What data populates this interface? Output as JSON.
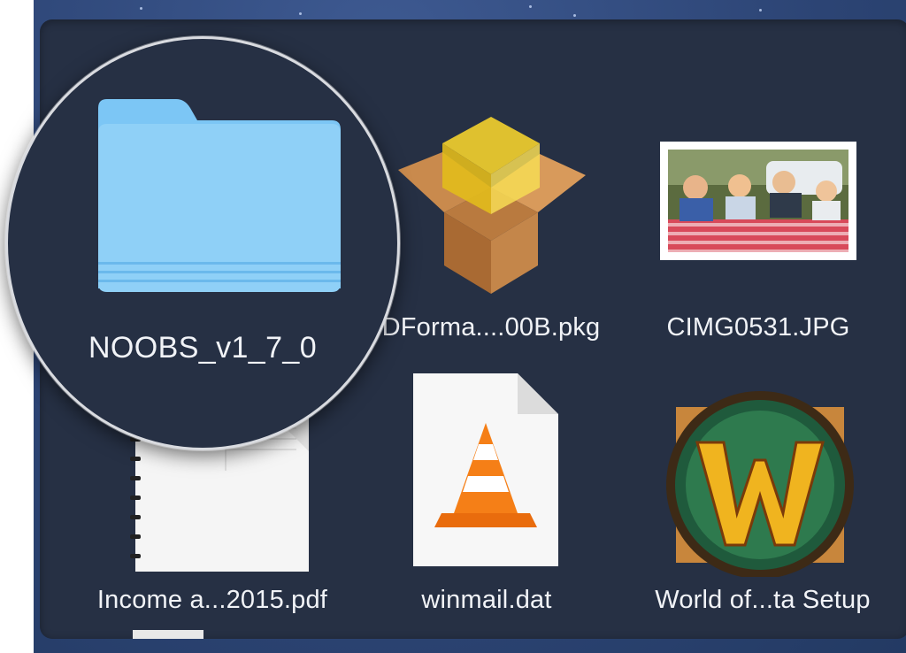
{
  "desktop_stack": {
    "items": [
      {
        "name": "NOOBS_v1_7_0",
        "type": "folder-icon"
      },
      {
        "name": "DForma....00B.pkg",
        "type": "package-icon"
      },
      {
        "name": "CIMG0531.JPG",
        "type": "photo-icon"
      },
      {
        "name": "Income a...2015.pdf",
        "type": "pdf-document-icon"
      },
      {
        "name": "winmail.dat",
        "type": "vlc-document-icon"
      },
      {
        "name": "World of...ta Setup",
        "type": "world-of-warcraft-icon"
      }
    ]
  },
  "colors": {
    "desktop": "#2c4474",
    "stack_background": "#263044",
    "folder": "#7cc6f5",
    "label_text": "#f1f3f7"
  }
}
